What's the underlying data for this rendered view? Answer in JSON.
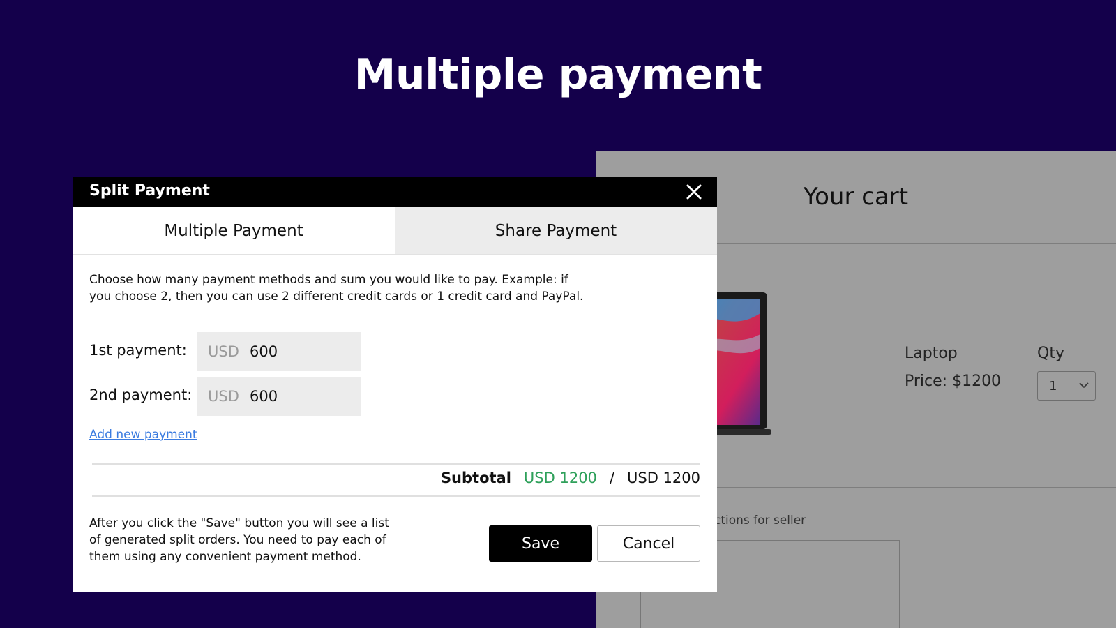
{
  "page": {
    "title": "Multiple payment"
  },
  "cart": {
    "title": "Your cart",
    "product_name": "Laptop",
    "product_price": "Price: $1200",
    "qty_label": "Qty",
    "qty_value": "1",
    "seller_label": "ctions for seller"
  },
  "modal": {
    "title": "Split Payment",
    "tabs": [
      {
        "label": "Multiple Payment",
        "active": true
      },
      {
        "label": "Share Payment",
        "active": false
      }
    ],
    "description": "Choose how many payment methods and sum you would like to pay. Example: if you choose 2, then you can use 2 different credit cards or 1 credit card and PayPal.",
    "payments": [
      {
        "label": "1st payment:",
        "currency": "USD",
        "amount": "600"
      },
      {
        "label": "2nd payment:",
        "currency": "USD",
        "amount": "600"
      }
    ],
    "add_payment_label": "Add new payment",
    "subtotal": {
      "label": "Subtotal",
      "current": "USD 1200",
      "separator": "/",
      "total": "USD 1200",
      "current_color": "#2ea05a"
    },
    "footer_note": "After you click the \"Save\" button you will see a list of generated split orders. You need to pay each of them using any convenient payment method.",
    "save_label": "Save",
    "cancel_label": "Cancel"
  },
  "colors": {
    "background": "#14004b",
    "link": "#3a7be0",
    "header": "#000000"
  }
}
